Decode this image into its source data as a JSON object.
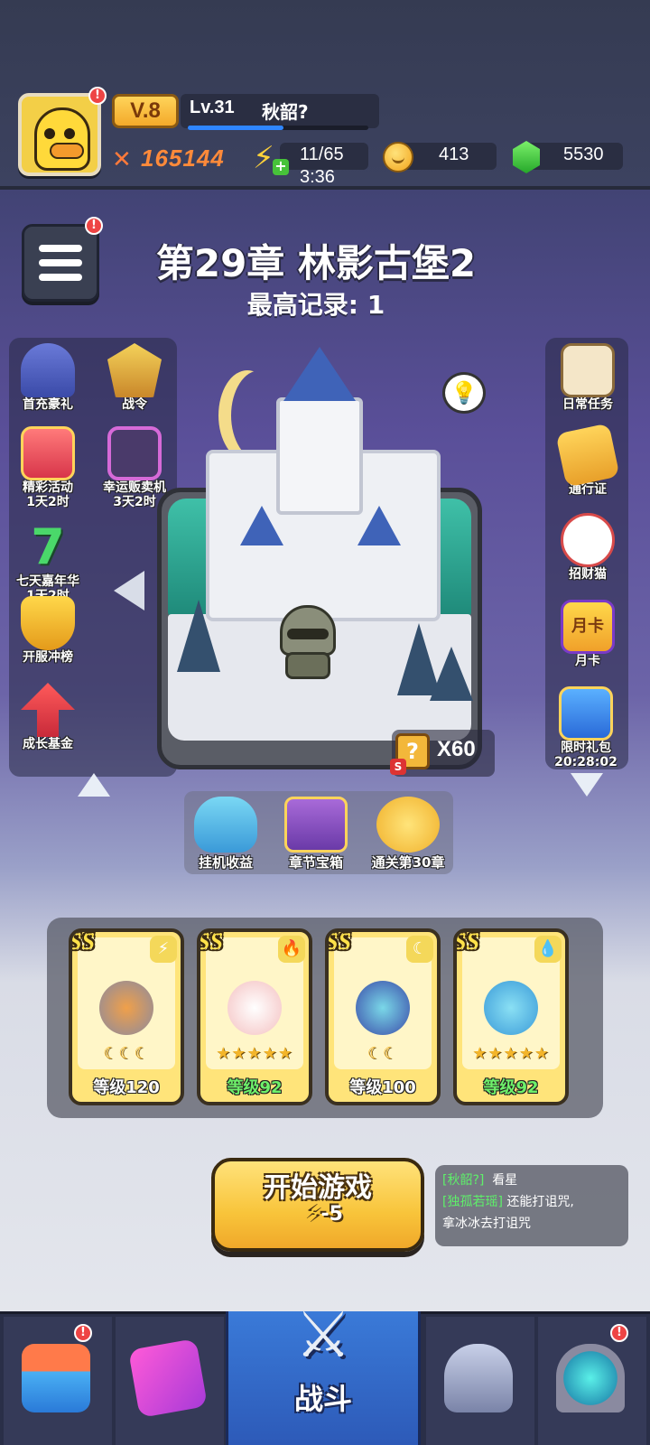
{
  "header": {
    "vip": "V.8",
    "level": "Lv.31",
    "player_name": "秋韶?",
    "xp_progress": 0.53,
    "combat_power": "165144",
    "energy": "11/65",
    "energy_timer": "3:36",
    "coins": "413",
    "gems": "5530"
  },
  "chapter": {
    "title": "第29章  林影古堡2",
    "record": "最高记录:  1"
  },
  "left_menu": [
    {
      "label": "首充豪礼",
      "sub": ""
    },
    {
      "label": "战令",
      "sub": ""
    },
    {
      "label": "精彩活动",
      "sub": "1天2时"
    },
    {
      "label": "幸运贩卖机",
      "sub": "3天2时"
    },
    {
      "label": "七天嘉年华",
      "sub": "1天2时"
    },
    {
      "label": "开服冲榜",
      "sub": ""
    },
    {
      "label": "成长基金",
      "sub": ""
    }
  ],
  "right_menu": [
    {
      "label": "日常任务",
      "sub": ""
    },
    {
      "label": "通行证",
      "sub": ""
    },
    {
      "label": "招财猫",
      "sub": ""
    },
    {
      "label": "月卡",
      "sub": ""
    },
    {
      "label": "限时礼包",
      "sub": "20:28:02"
    }
  ],
  "chest_count": "X60",
  "chest_badge": "S",
  "rewards": [
    {
      "label": "挂机收益"
    },
    {
      "label": "章节宝箱"
    },
    {
      "label": "通关第30章"
    }
  ],
  "heroes": [
    {
      "rank": "SS",
      "element_icon": "lightning-icon",
      "stars": "☾☾☾",
      "level": "等级120",
      "level_color": "#ffffff"
    },
    {
      "rank": "SS",
      "element_icon": "fire-icon",
      "stars": "★★★★★",
      "level": "等级92",
      "level_color": "#6ef06a"
    },
    {
      "rank": "SS",
      "element_icon": "moon-icon",
      "stars": "☾☾",
      "level": "等级100",
      "level_color": "#ffffff"
    },
    {
      "rank": "SS",
      "element_icon": "water-icon",
      "stars": "★★★★★",
      "level": "等级92",
      "level_color": "#6ef06a"
    }
  ],
  "start": {
    "label": "开始游戏",
    "cost": "-5"
  },
  "chat": [
    {
      "tag": "[秋韶?]",
      "text": "看星"
    },
    {
      "tag": "[独孤若瑶]",
      "text": "还能打诅咒,"
    },
    {
      "tag": "",
      "text": "拿冰冰去打诅咒"
    }
  ],
  "nav": {
    "active_label": "战斗",
    "items": [
      "shop-icon",
      "cards-icon",
      "battle-icon",
      "armor-icon",
      "portal-icon"
    ]
  },
  "colors": {
    "accent_gold": "#f8c43a",
    "power_orange": "#ff8a3a",
    "chat_tag_green": "#5ef06a",
    "nav_active_blue": "#3a7ad8"
  }
}
